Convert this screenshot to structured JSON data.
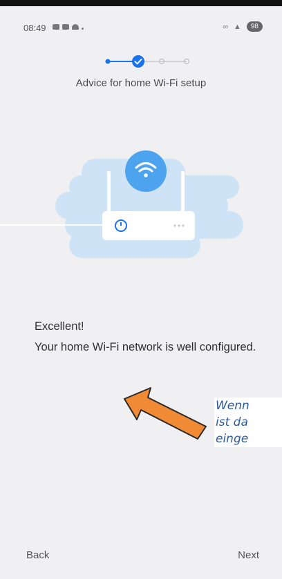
{
  "status_bar": {
    "time": "08:49",
    "battery": "98"
  },
  "stepper": {
    "steps_total": 4,
    "current_step": 2
  },
  "header": {
    "subtitle": "Advice for home Wi-Fi setup"
  },
  "message": {
    "line1": "Excellent!",
    "line2": "Your home Wi-Fi network is well configured."
  },
  "annotation": {
    "line1": "Wenn",
    "line2": "ist da",
    "line3": "einge"
  },
  "footer": {
    "back_label": "Back",
    "next_label": "Next"
  },
  "colors": {
    "accent": "#1a73e8",
    "illustration_light": "#cfe3f7",
    "arrow": "#f08a34",
    "annotation_text": "#2e5c9a"
  }
}
